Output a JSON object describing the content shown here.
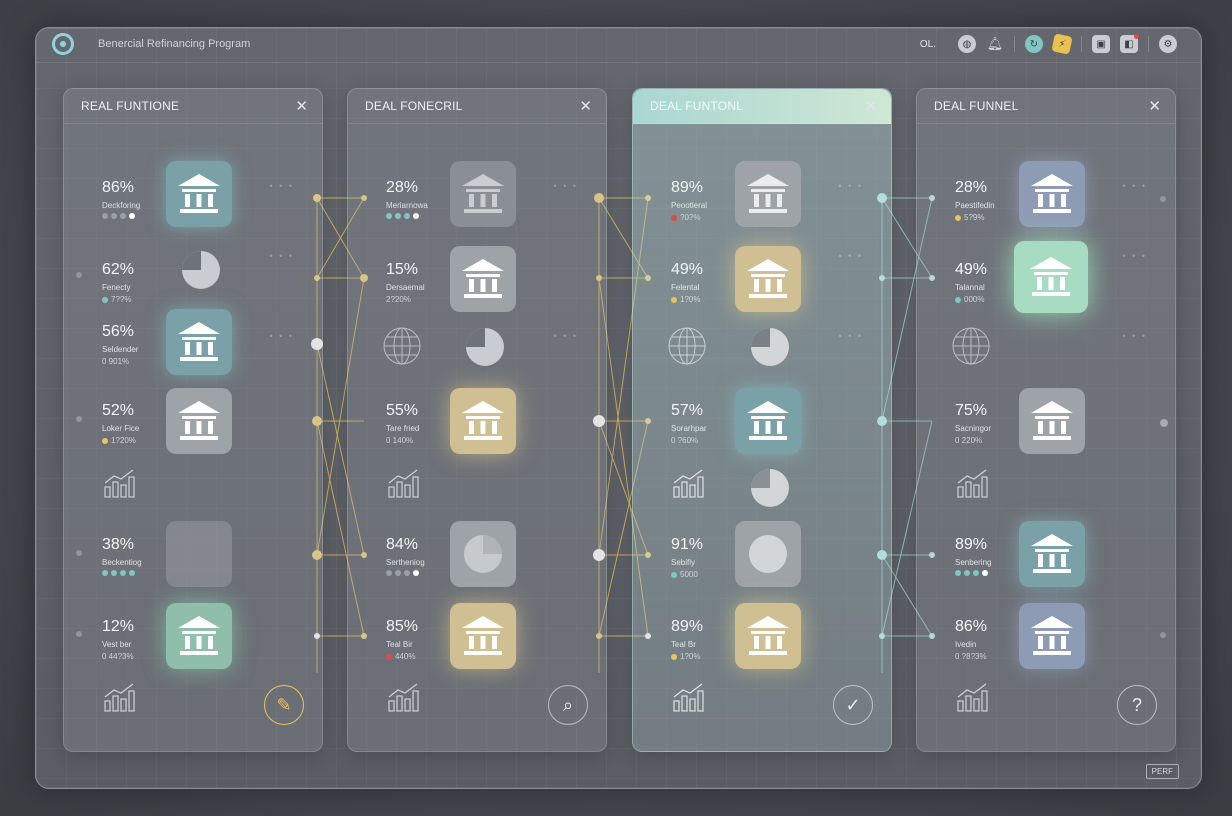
{
  "app": {
    "title": "Benercial Refinancing Program",
    "top_label": "OL."
  },
  "panels": [
    {
      "title": "REAL FUNTIONE",
      "rows": [
        {
          "pct": "86%",
          "sub": "Deckforing",
          "meta": ""
        },
        {
          "pct": "62%",
          "sub": "Fenecty",
          "meta": "7??%"
        },
        {
          "pct": "56%",
          "sub": "Seldender",
          "meta": "0 901%"
        },
        {
          "pct": "52%",
          "sub": "Loker Fice",
          "meta": "1?20%"
        },
        {
          "pct": "38%",
          "sub": "Beckentiog",
          "meta": ""
        },
        {
          "pct": "12%",
          "sub": "Vest ber",
          "meta": "0 44?3%"
        }
      ]
    },
    {
      "title": "DEAL FONECRIL",
      "rows": [
        {
          "pct": "28%",
          "sub": "Meriarnowa",
          "meta": ""
        },
        {
          "pct": "15%",
          "sub": "Dersaemal",
          "meta": "2?20%"
        },
        {
          "pct": "55%",
          "sub": "Tare fried",
          "meta": "0 140%"
        },
        {
          "pct": "84%",
          "sub": "Sertheniog",
          "meta": ""
        },
        {
          "pct": "85%",
          "sub": "Teal Bir",
          "meta": "440%"
        }
      ]
    },
    {
      "title": "DEAL FUNTONL",
      "rows": [
        {
          "pct": "89%",
          "sub": "Peootleral",
          "meta": "?0?%"
        },
        {
          "pct": "49%",
          "sub": "Felental",
          "meta": "1?0%"
        },
        {
          "pct": "57%",
          "sub": "Sorarhpar",
          "meta": "0 ?60%"
        },
        {
          "pct": "91%",
          "sub": "Sebifly",
          "meta": "5000"
        },
        {
          "pct": "89%",
          "sub": "Teal Br",
          "meta": "1?0%"
        }
      ]
    },
    {
      "title": "DEAL FUNNEL",
      "rows": [
        {
          "pct": "28%",
          "sub": "Paestifedin",
          "meta": "5?9%"
        },
        {
          "pct": "49%",
          "sub": "Talannal",
          "meta": "000%"
        },
        {
          "pct": "75%",
          "sub": "Sacningor",
          "meta": "0 220%"
        },
        {
          "pct": "89%",
          "sub": "Senbering",
          "meta": ""
        },
        {
          "pct": "86%",
          "sub": "Ivedin",
          "meta": "0 ?8?3%"
        }
      ]
    }
  ],
  "footer": {
    "button": "PERF"
  },
  "colors": {
    "teal": "#8fd3dc",
    "gold": "#e8c45c",
    "red": "#e04848",
    "green": "#7fc7c0"
  }
}
